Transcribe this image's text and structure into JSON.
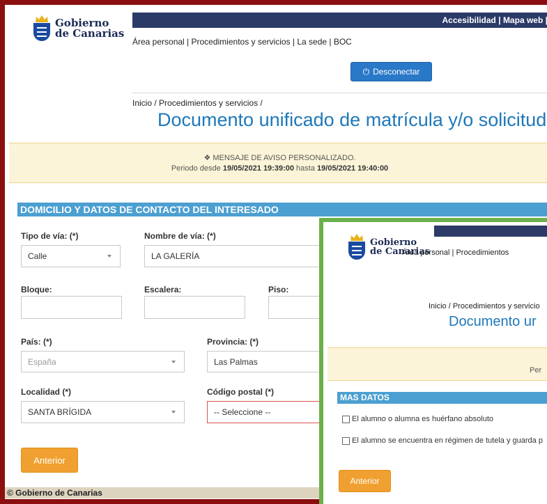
{
  "header": {
    "top_links": [
      "Accesibilidad",
      "Mapa web"
    ],
    "logo_line1": "Gobierno",
    "logo_line2": "de Canarias",
    "nav": "Área personal | Procedimientos y servicios | La sede | BOC",
    "disconnect_label": "Desconectar"
  },
  "breadcrumb": "Inicio / Procedimientos y servicios /",
  "page_title": "Documento unificado de matrícula y/o solicitud de s",
  "alert": {
    "title": "MENSAJE DE AVISO PERSONALIZADO.",
    "period_prefix": "Periodo desde",
    "from": "19/05/2021 19:39:00",
    "middle": "hasta",
    "to": "19/05/2021 19:40:00"
  },
  "section": {
    "title": "DOMICILIO Y DATOS DE CONTACTO DEL INTERESADO"
  },
  "form": {
    "tipo_via": {
      "label": "Tipo de vía: (*)",
      "value": "Calle"
    },
    "nombre_via": {
      "label": "Nombre de vía: (*)",
      "value": "LA GALERÍA"
    },
    "bloque": {
      "label": "Bloque:",
      "value": ""
    },
    "escalera": {
      "label": "Escalera:",
      "value": ""
    },
    "piso": {
      "label": "Piso:",
      "value": ""
    },
    "pais": {
      "label": "País: (*)",
      "value": "España"
    },
    "provincia": {
      "label": "Provincia: (*)",
      "value": "Las Palmas"
    },
    "localidad": {
      "label": "Localidad (*)",
      "value": "SANTA BRÍGIDA"
    },
    "codigo_postal": {
      "label": "Código postal (*)",
      "value": "-- Seleccione --"
    }
  },
  "back_label": "Anterior",
  "footer": "© Gobierno de Canarias",
  "overlay": {
    "logo_line1": "Gobierno",
    "logo_line2": "de Canarias",
    "nav": "Área personal | Procedimientos",
    "breadcrumb": "Inicio / Procedimientos y servicio",
    "title": "Documento ur",
    "alert_fragment": "Per",
    "section_title": "MAS DATOS",
    "check1": "El alumno o alumna es huérfano absoluto",
    "check2": "El alumno se encuentra en régimen de tutela y guarda p",
    "back_label": "Anterior"
  },
  "colors": {
    "frame_red": "#8b0f0f",
    "frame_green": "#6ab04c",
    "title_blue": "#1e78b8",
    "section_blue": "#4b9fd1",
    "button_orange": "#f0a030"
  }
}
